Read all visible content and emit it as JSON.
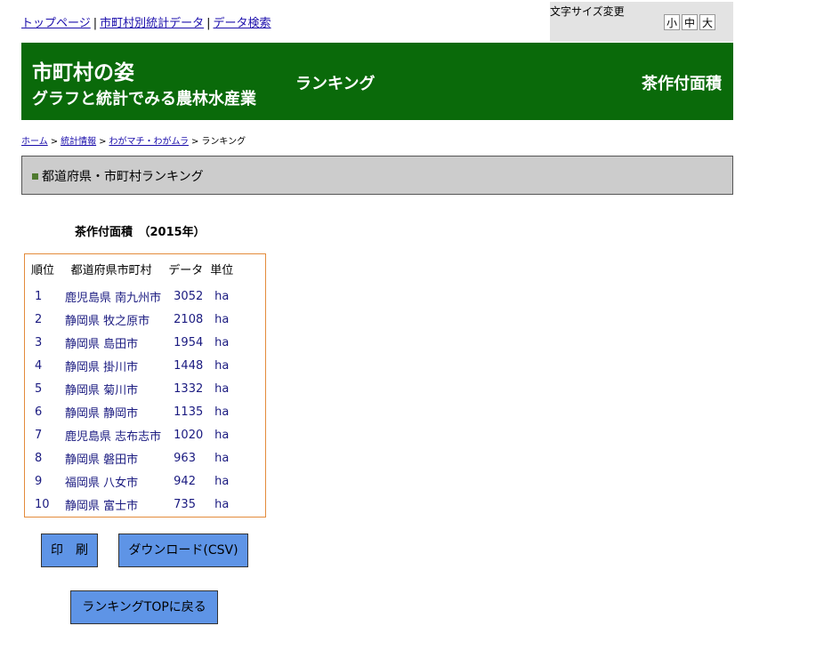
{
  "topnav": {
    "top_page": "トップページ",
    "municipal_data": "市町村別統計データ",
    "data_search": "データ検索",
    "separator": "|"
  },
  "font_size": {
    "label": "文字サイズ変更",
    "small": "小",
    "medium": "中",
    "large": "大"
  },
  "header": {
    "title_line1": "市町村の姿",
    "title_line2": "グラフと統計でみる農林水産業",
    "middle": "ランキング",
    "right": "茶作付面積"
  },
  "breadcrumb": {
    "home": "ホーム",
    "stats_info": "統計情報",
    "wagamachi": "わがマチ・わがムラ",
    "current": "ランキング",
    "gt": ">"
  },
  "section": {
    "title": "都道府県・市町村ランキング"
  },
  "ranking": {
    "title": "茶作付面積　（2015年）",
    "columns": [
      "順位",
      "都道府県市町村",
      "データ",
      "単位"
    ],
    "rows": [
      {
        "rank": "1",
        "place": "鹿児島県 南九州市",
        "value": "3052",
        "unit": "ha"
      },
      {
        "rank": "2",
        "place": "静岡県 牧之原市",
        "value": "2108",
        "unit": "ha"
      },
      {
        "rank": "3",
        "place": "静岡県 島田市",
        "value": "1954",
        "unit": "ha"
      },
      {
        "rank": "4",
        "place": "静岡県 掛川市",
        "value": "1448",
        "unit": "ha"
      },
      {
        "rank": "5",
        "place": "静岡県 菊川市",
        "value": "1332",
        "unit": "ha"
      },
      {
        "rank": "6",
        "place": "静岡県 静岡市",
        "value": "1135",
        "unit": "ha"
      },
      {
        "rank": "7",
        "place": "鹿児島県 志布志市",
        "value": "1020",
        "unit": "ha"
      },
      {
        "rank": "8",
        "place": "静岡県 磐田市",
        "value": "963",
        "unit": "ha"
      },
      {
        "rank": "9",
        "place": "福岡県 八女市",
        "value": "942",
        "unit": "ha"
      },
      {
        "rank": "10",
        "place": "静岡県 富士市",
        "value": "735",
        "unit": "ha"
      }
    ]
  },
  "buttons": {
    "print": "印　刷",
    "download_csv": "ダウンロード(CSV)",
    "back_to_top": "ランキングTOPに戻る"
  },
  "colors": {
    "header_green": "#0a6a0a",
    "section_gray": "#cccccc",
    "table_border_orange": "#e38b3b",
    "button_blue": "#5e94e6"
  }
}
